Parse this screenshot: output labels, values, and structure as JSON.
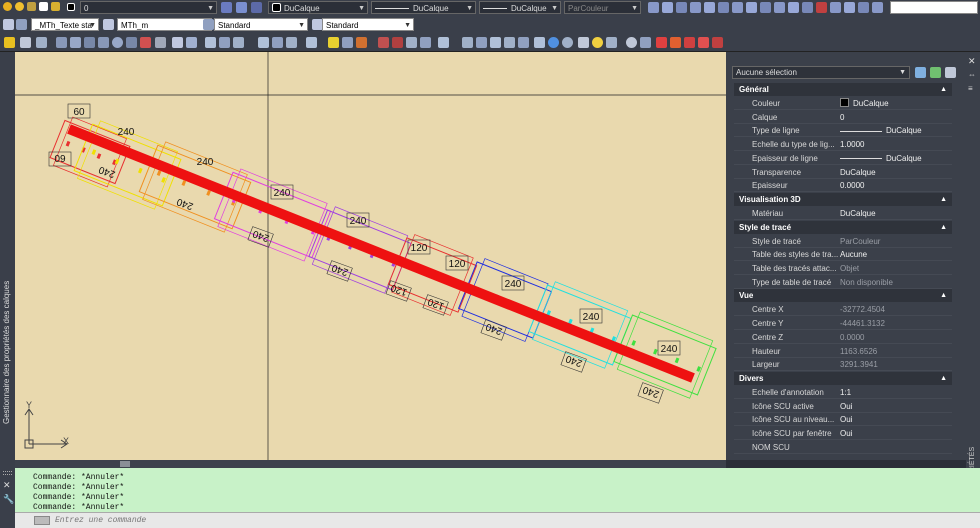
{
  "toolbar1": {
    "layer_value": "0",
    "color_value": "DuCalque",
    "linetype_value": "DuCalque",
    "lineweight_value": "DuCalque",
    "plotstyle_value": "ParCouleur"
  },
  "toolbar2": {
    "textstyle_value": "_MTh_Texte sta",
    "dimstyle_value": "MTh_m",
    "tablestyle_value": "Standard",
    "multileader_value": "Standard"
  },
  "left_palette_title": "Gestionnaire des propriétés des calques",
  "drawing": {
    "dim_labels": [
      "60",
      "240",
      "60",
      "240",
      "240",
      "240",
      "240",
      "240",
      "240",
      "240",
      "120",
      "120",
      "120",
      "120",
      "240",
      "240",
      "240",
      "240",
      "240",
      "240"
    ],
    "ucs_y_label": "Y",
    "ucs_x_label": "X",
    "colors": {
      "background": "#e9d9ae",
      "main_line": "#ee1111",
      "red": "#e83030",
      "yellow": "#f0e000",
      "orange": "#f09020",
      "magenta": "#e040e0",
      "purple": "#a040e0",
      "blue": "#2030e0",
      "cyan": "#20e0e0",
      "green": "#40e040"
    }
  },
  "properties": {
    "selection": "Aucune sélection",
    "sections": [
      {
        "title": "Général",
        "rows": [
          {
            "label": "Couleur",
            "value": "DuCalque"
          },
          {
            "label": "Calque",
            "value": "0"
          },
          {
            "label": "Type de ligne",
            "value": "DuCalque"
          },
          {
            "label": "Echelle du type de lig...",
            "value": "1.0000"
          },
          {
            "label": "Epaisseur de ligne",
            "value": "DuCalque"
          },
          {
            "label": "Transparence",
            "value": "DuCalque"
          },
          {
            "label": "Epaisseur",
            "value": "0.0000"
          }
        ]
      },
      {
        "title": "Visualisation 3D",
        "rows": [
          {
            "label": "Matériau",
            "value": "DuCalque"
          }
        ]
      },
      {
        "title": "Style de tracé",
        "rows": [
          {
            "label": "Style de tracé",
            "value": "ParCouleur"
          },
          {
            "label": "Table des styles de tra...",
            "value": "Aucune"
          },
          {
            "label": "Table des tracés attac...",
            "value": "Objet"
          },
          {
            "label": "Type de table de tracé",
            "value": "Non disponible"
          }
        ]
      },
      {
        "title": "Vue",
        "rows": [
          {
            "label": "Centre X",
            "value": "-32772.4504"
          },
          {
            "label": "Centre Y",
            "value": "-44461.3132"
          },
          {
            "label": "Centre Z",
            "value": "0.0000"
          },
          {
            "label": "Hauteur",
            "value": "1163.6526"
          },
          {
            "label": "Largeur",
            "value": "3291.3941"
          }
        ]
      },
      {
        "title": "Divers",
        "rows": [
          {
            "label": "Echelle d'annotation",
            "value": "1:1"
          },
          {
            "label": "Icône SCU active",
            "value": "Oui"
          },
          {
            "label": "Icône SCU au niveau...",
            "value": "Oui"
          },
          {
            "label": "Icône SCU par fenêtre",
            "value": "Oui"
          },
          {
            "label": "NOM SCU",
            "value": ""
          }
        ]
      }
    ],
    "side_tab": "PROPRIÉTÉS"
  },
  "command": {
    "history": [
      "Commande: *Annuler*",
      "Commande: *Annuler*",
      "Commande: *Annuler*",
      "Commande: *Annuler*"
    ],
    "placeholder": "Entrez une commande"
  }
}
